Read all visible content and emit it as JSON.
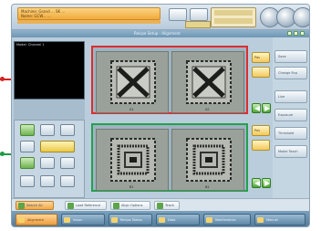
{
  "header": {
    "status_line_1": "Machine: Grand ... SK ...",
    "status_line_2": "Name: GCW... ...",
    "mini_status_1": "",
    "mini_status_2": ""
  },
  "titlebar": {
    "title": "Recipe Setup - Alignment"
  },
  "left": {
    "panel_label": "Model: Channel 1"
  },
  "top_panel": {
    "label": "",
    "left_num": "A1",
    "right_num": "A2"
  },
  "bottom_panel": {
    "label": "",
    "left_num": "B1",
    "right_num": "B2"
  },
  "side": {
    "top_box": "Pos",
    "bottom_box": "Pos"
  },
  "right": {
    "buttons": [
      "Save",
      "Change Rcp",
      "Live",
      "Exposure",
      "Threshold",
      "Model Teach"
    ]
  },
  "tools": [
    {
      "label": "Search All"
    },
    {
      "label": "Load Reference"
    },
    {
      "label": "Align Options"
    },
    {
      "label": "Teach"
    }
  ],
  "tabs": [
    {
      "label": "Alignment"
    },
    {
      "label": "Vision"
    },
    {
      "label": "Recipe Status"
    },
    {
      "label": "Data"
    },
    {
      "label": "Maintenance"
    },
    {
      "label": "Manual"
    }
  ],
  "colors": {
    "callout_red": "#dd2e2e",
    "callout_green": "#23a24a",
    "accent_orange": "#f1a93b"
  }
}
